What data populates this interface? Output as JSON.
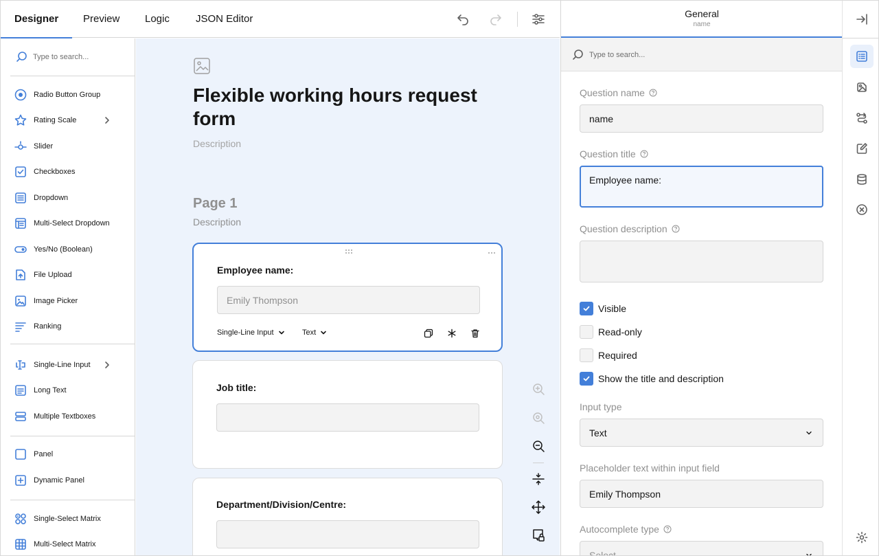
{
  "tabs": [
    {
      "label": "Designer"
    },
    {
      "label": "Preview"
    },
    {
      "label": "Logic"
    },
    {
      "label": "JSON Editor"
    }
  ],
  "toolbox": {
    "search_placeholder": "Type to search...",
    "items": [
      {
        "label": "Radio Button Group",
        "icon": "radio-group-icon"
      },
      {
        "label": "Rating Scale",
        "icon": "rating-icon"
      },
      {
        "label": "Slider",
        "icon": "slider-icon"
      },
      {
        "label": "Checkboxes",
        "icon": "checkbox-icon"
      },
      {
        "label": "Dropdown",
        "icon": "dropdown-icon"
      },
      {
        "label": "Multi-Select Dropdown",
        "icon": "tagbox-icon"
      },
      {
        "label": "Yes/No (Boolean)",
        "icon": "boolean-icon"
      },
      {
        "label": "File Upload",
        "icon": "file-icon"
      },
      {
        "label": "Image Picker",
        "icon": "image-picker-icon"
      },
      {
        "label": "Ranking",
        "icon": "ranking-icon"
      },
      {
        "label": "Single-Line Input",
        "icon": "text-icon"
      },
      {
        "label": "Long Text",
        "icon": "comment-icon"
      },
      {
        "label": "Multiple Textboxes",
        "icon": "multiple-text-icon"
      },
      {
        "label": "Panel",
        "icon": "panel-icon"
      },
      {
        "label": "Dynamic Panel",
        "icon": "dynamic-panel-icon"
      },
      {
        "label": "Single-Select Matrix",
        "icon": "matrix-icon"
      },
      {
        "label": "Multi-Select Matrix",
        "icon": "matrix-dropdown-icon"
      }
    ]
  },
  "survey": {
    "title": "Flexible working hours request form",
    "description_placeholder": "Description",
    "page_title": "Page 1",
    "page_description_placeholder": "Description",
    "questions": [
      {
        "title": "Employee name:",
        "placeholder": "Emily Thompson",
        "type_label": "Single-Line Input",
        "input_type_label": "Text"
      },
      {
        "title": "Job title:",
        "placeholder": ""
      },
      {
        "title": "Department/Division/Centre:",
        "placeholder": ""
      }
    ]
  },
  "properties": {
    "category": "General",
    "subtitle": "name",
    "search_placeholder": "Type to search...",
    "question_name_label": "Question name",
    "question_name_value": "name",
    "question_title_label": "Question title",
    "question_title_value": "Employee name:",
    "question_description_label": "Question description",
    "question_description_value": "",
    "checkboxes": [
      {
        "label": "Visible",
        "checked": true
      },
      {
        "label": "Read-only",
        "checked": false
      },
      {
        "label": "Required",
        "checked": false
      },
      {
        "label": "Show the title and description",
        "checked": true
      }
    ],
    "input_type_label": "Input type",
    "input_type_value": "Text",
    "placeholder_label": "Placeholder text within input field",
    "placeholder_value": "Emily Thompson",
    "autocomplete_label": "Autocomplete type",
    "autocomplete_value": "Select..."
  },
  "colors": {
    "accent": "#437fd9",
    "surface": "#edf3fc"
  }
}
